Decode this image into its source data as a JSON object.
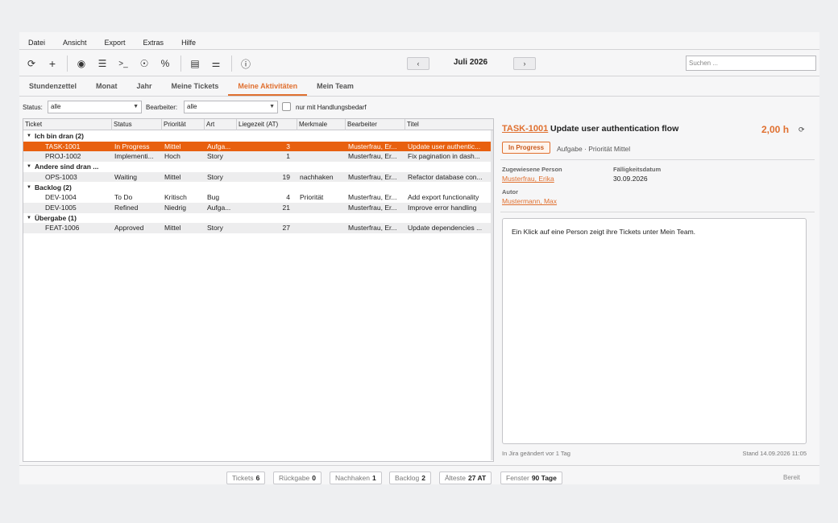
{
  "menu": [
    "Datei",
    "Ansicht",
    "Export",
    "Extras",
    "Hilfe"
  ],
  "toolbar": {
    "icons": [
      "refresh-icon",
      "add-icon",
      "eye-icon",
      "list-icon",
      "terminal-icon",
      "agent-icon",
      "percent-icon",
      "gantt-icon",
      "sliders-icon",
      "info-icon"
    ],
    "prev": "‹",
    "next": "›",
    "month": "Juli 2026",
    "search_placeholder": "Suchen ..."
  },
  "tabs": [
    "Stundenzettel",
    "Monat",
    "Jahr",
    "Meine Tickets",
    "Meine Aktivitäten",
    "Mein Team"
  ],
  "active_tab": 4,
  "filters": {
    "status_label": "Status:",
    "status_value": "alle",
    "bearbeiter_label": "Bearbeiter:",
    "bearbeiter_value": "alle",
    "checkbox_label": "nur mit Handlungsbedarf"
  },
  "table": {
    "columns": [
      "Ticket",
      "Status",
      "Priorität",
      "Art",
      "Liegezeit (AT)",
      "Merkmale",
      "Bearbeiter",
      "Titel"
    ],
    "rows": [
      {
        "group": true,
        "label": "Ich bin dran  (2)"
      },
      {
        "ticket": "TASK-1001",
        "status": "In Progress",
        "prio": "Mittel",
        "art": "Aufga...",
        "liegezeit": "3",
        "merkmale": "",
        "bearbeiter": "Musterfrau, Er...",
        "titel": "Update user authentic...",
        "selected": true
      },
      {
        "ticket": "PROJ-1002",
        "status": "Implementi...",
        "prio": "Hoch",
        "art": "Story",
        "liegezeit": "1",
        "merkmale": "",
        "bearbeiter": "Musterfrau, Er...",
        "titel": "Fix pagination in dash...",
        "alt": true
      },
      {
        "group": true,
        "label": "Andere sind dran ..."
      },
      {
        "ticket": "OPS-1003",
        "status": "Waiting",
        "prio": "Mittel",
        "art": "Story",
        "liegezeit": "19",
        "merkmale": "nachhaken",
        "bearbeiter": "Musterfrau, Er...",
        "titel": "Refactor database con...",
        "alt": true
      },
      {
        "group": true,
        "label": "Backlog  (2)"
      },
      {
        "ticket": "DEV-1004",
        "status": "To Do",
        "prio": "Kritisch",
        "art": "Bug",
        "liegezeit": "4",
        "merkmale": "Priorität",
        "bearbeiter": "Musterfrau, Er...",
        "titel": "Add export functionality"
      },
      {
        "ticket": "DEV-1005",
        "status": "Refined",
        "prio": "Niedrig",
        "art": "Aufga...",
        "liegezeit": "21",
        "merkmale": "",
        "bearbeiter": "Musterfrau, Er...",
        "titel": "Improve error handling",
        "alt": true
      },
      {
        "group": true,
        "label": "Übergabe  (1)"
      },
      {
        "ticket": "FEAT-1006",
        "status": "Approved",
        "prio": "Mittel",
        "art": "Story",
        "liegezeit": "27",
        "merkmale": "",
        "bearbeiter": "Musterfrau, Er...",
        "titel": "Update dependencies ...",
        "alt": true
      }
    ]
  },
  "detail": {
    "id": "TASK-1001",
    "title": "Update user authentication flow",
    "hours": "2,00 h",
    "status": "In Progress",
    "meta": "Aufgabe · Priorität Mittel",
    "assignee_label": "Zugewiesene Person",
    "assignee": "Musterfrau, Erika",
    "due_label": "Fälligkeitsdatum",
    "due": "30.09.2026",
    "author_label": "Autor",
    "author": "Mustermann, Max",
    "note": "Ein Klick auf eine Person zeigt ihre Tickets unter Mein Team.",
    "changed": "In Jira geändert vor 1 Tag",
    "stand": "Stand 14.09.2026 11:05"
  },
  "status": {
    "chips": [
      {
        "label": "Tickets",
        "value": "6"
      },
      {
        "label": "Rückgabe",
        "value": "0"
      },
      {
        "label": "Nachhaken",
        "value": "1"
      },
      {
        "label": "Backlog",
        "value": "2"
      },
      {
        "label": "Älteste",
        "value": "27 AT"
      },
      {
        "label": "Fenster",
        "value": "90 Tage"
      }
    ],
    "ready": "Bereit"
  }
}
